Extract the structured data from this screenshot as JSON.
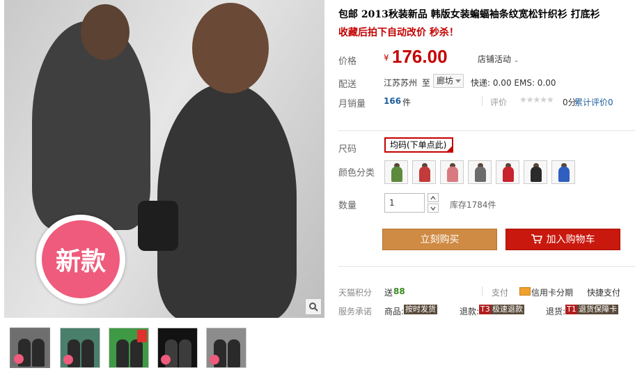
{
  "product": {
    "title": "包邮 2013秋装新品 韩版女装蝙蝠袖条纹宽松针织衫 打底衫",
    "subtitle": "收藏后拍下自动改价 秒杀！",
    "image_badge": "新款",
    "icons": {
      "zoom": "magnifier-icon",
      "cart": "cart-icon",
      "card": "credit-card-icon",
      "rating": "star-icon"
    }
  },
  "price": {
    "label": "价格",
    "currency": "¥",
    "value": "176.00",
    "promo": "店铺活动"
  },
  "shipping": {
    "label": "配送",
    "from": "江苏苏州",
    "to_word": "至",
    "to_city": "廊坊",
    "fee": "快递: 0.00 EMS: 0.00"
  },
  "sales": {
    "label": "月销量",
    "count": "166",
    "unit": "件",
    "rating_label": "评价",
    "stars": "★★★★★",
    "rating_text": "0分",
    "rating_link": "累计评价0"
  },
  "size": {
    "label": "尺码",
    "selected": "均码(下单点此)"
  },
  "color": {
    "label": "颜色分类"
  },
  "quantity": {
    "label": "数量",
    "value": "1",
    "stock": "库存1784件"
  },
  "actions": {
    "buy": "立刻购买",
    "cart": "加入购物车"
  },
  "points": {
    "label": "天猫积分",
    "send": "送",
    "value": "88",
    "pay_label": "支付",
    "card_text": "信用卡分期",
    "fast_pay": "快捷支付"
  },
  "service": {
    "label": "服务承诺",
    "items": [
      {
        "prefix": "商品:",
        "tag": "按时发货"
      },
      {
        "prefix": "退款:",
        "code": "T3",
        "tag": "极速退款"
      },
      {
        "prefix": "退货:",
        "code": "T1",
        "tag": "退货保障卡"
      }
    ]
  },
  "thumbnails": {
    "badge": "新款"
  },
  "colors": {
    "accent": "#c40000",
    "buy": "#cf8a43",
    "cart": "#c9180d",
    "badge": "#ef5b7c"
  }
}
